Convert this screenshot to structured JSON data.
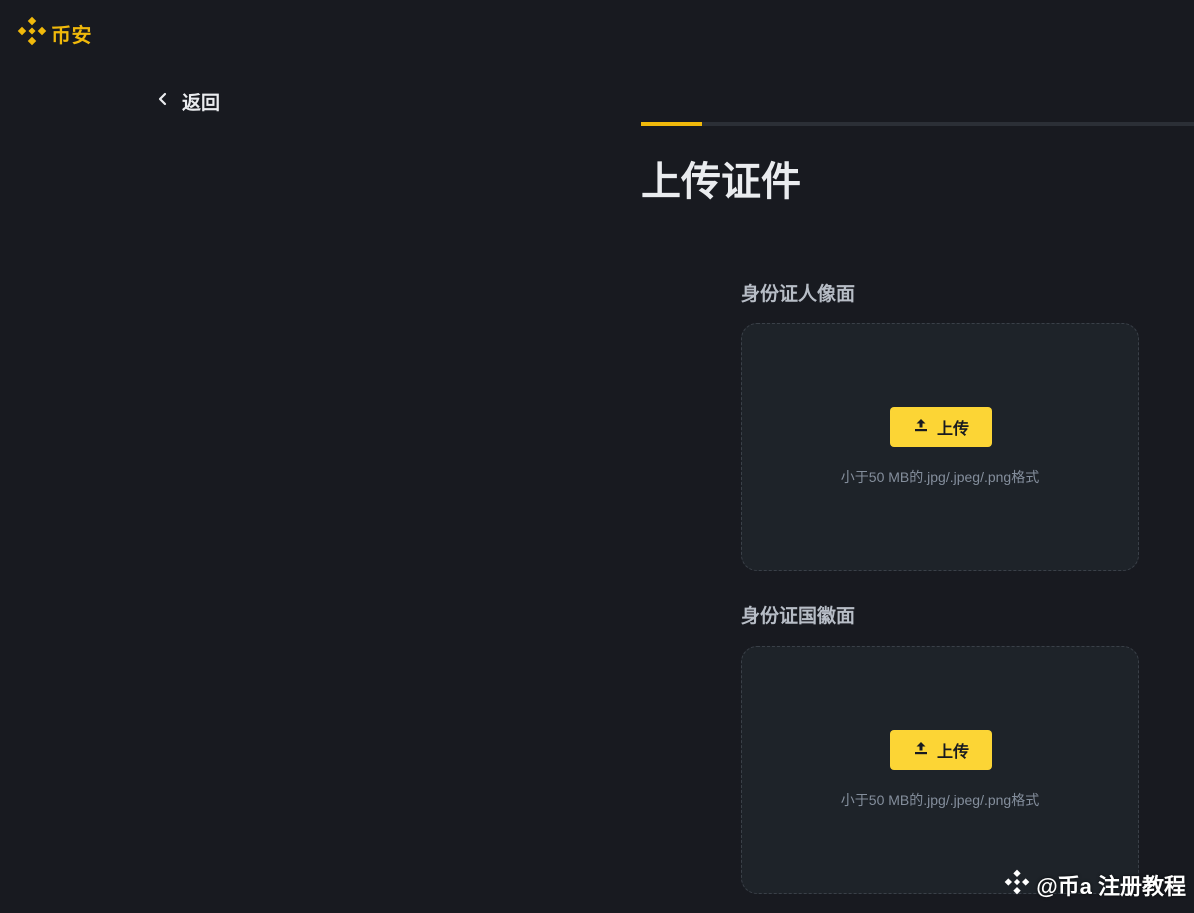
{
  "header": {
    "logo_text": "币安",
    "logo_icon": "binance-logo-icon",
    "accent_color": "#f0b90b"
  },
  "nav": {
    "back_label": "返回",
    "back_icon": "chevron-left-icon"
  },
  "progress": {
    "fraction": 0.11
  },
  "main": {
    "title": "上传证件",
    "sections": [
      {
        "label": "身份证人像面",
        "upload_label": "上传",
        "hint": "小于50 MB的.jpg/.jpeg/.png格式"
      },
      {
        "label": "身份证国徽面",
        "upload_label": "上传",
        "hint": "小于50 MB的.jpg/.jpeg/.png格式"
      }
    ]
  },
  "watermark": {
    "text": "@币a 注册教程"
  },
  "colors": {
    "background": "#181a20",
    "panel": "#1e2329",
    "button": "#fcd535",
    "muted_text": "#848e9c"
  }
}
